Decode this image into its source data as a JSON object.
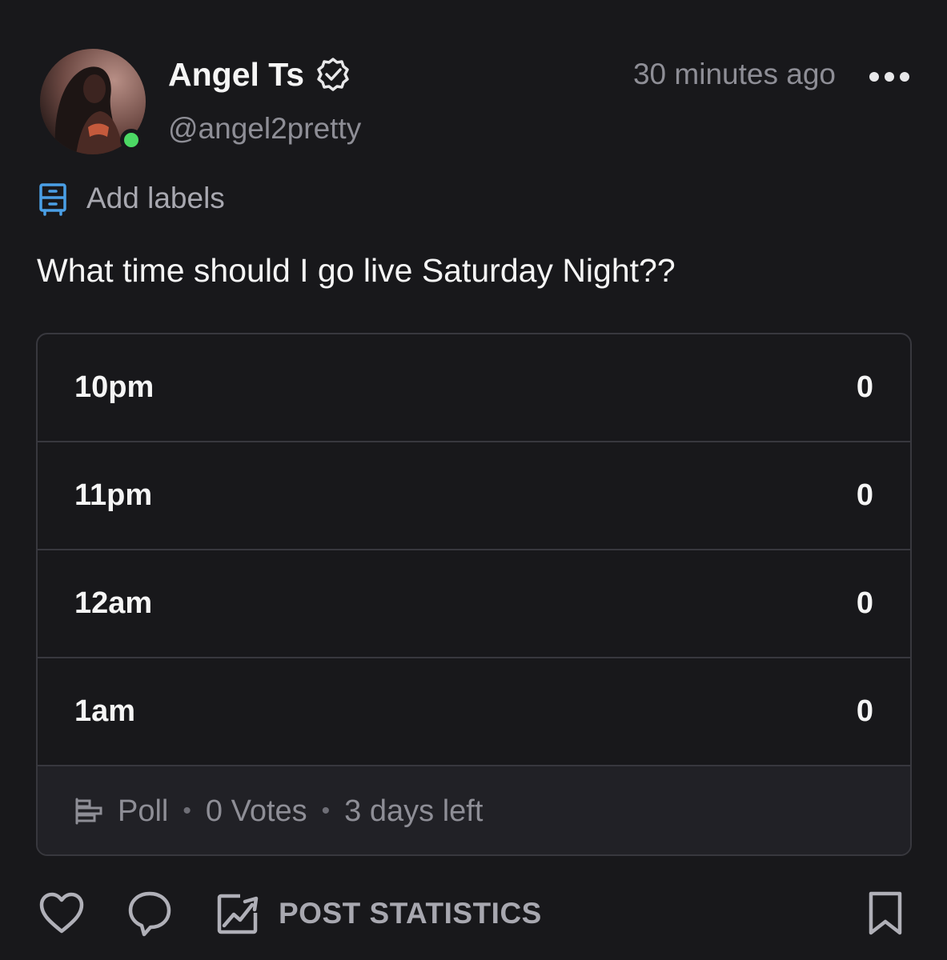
{
  "post": {
    "author_name": "Angel Ts",
    "author_handle": "@angel2pretty",
    "timestamp": "30 minutes ago",
    "labels_action": "Add labels",
    "text": "What time should I go live Saturday Night??"
  },
  "poll": {
    "options": [
      {
        "label": "10pm",
        "count": "0"
      },
      {
        "label": "11pm",
        "count": "0"
      },
      {
        "label": "12am",
        "count": "0"
      },
      {
        "label": "1am",
        "count": "0"
      }
    ],
    "footer": {
      "type": "Poll",
      "votes": "0 Votes",
      "time_left": "3 days left",
      "separator": "•"
    }
  },
  "actions": {
    "stats_label": "POST STATISTICS"
  },
  "icons": {
    "verified": "verified-badge-icon",
    "more": "more-dots-icon",
    "labels": "label-cabinet-icon",
    "poll": "poll-bars-icon",
    "like": "heart-icon",
    "comment": "comment-bubble-icon",
    "stats": "chart-image-icon",
    "bookmark": "bookmark-icon"
  },
  "colors": {
    "background": "#18181b",
    "online": "#4cd964",
    "accent_blue": "#4a9fe6",
    "muted_text": "#8e8e96"
  }
}
